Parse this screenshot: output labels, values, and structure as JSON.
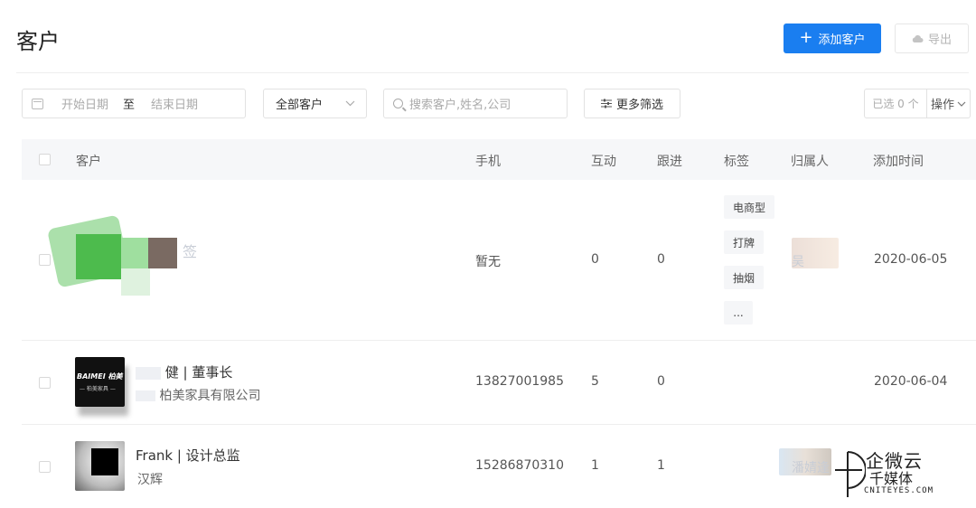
{
  "header": {
    "title": "客户",
    "add_button": "添加客户",
    "add_icon": "+",
    "export_button": "导出"
  },
  "filters": {
    "date_start_placeholder": "开始日期",
    "date_separator": "至",
    "date_end_placeholder": "结束日期",
    "customer_scope": "全部客户",
    "search_placeholder": "搜索客户,姓名,公司",
    "more_filters": "更多筛选",
    "selected_count": "已选 0 个",
    "operation": "操作"
  },
  "table": {
    "columns": [
      "客户",
      "手机",
      "互动",
      "跟进",
      "标签",
      "归属人",
      "添加时间"
    ],
    "rows": [
      {
        "customer_label": "签",
        "phone": "暂无",
        "interactions": "0",
        "followups": "0",
        "tags": [
          "电商型",
          "打牌",
          "抽烟",
          "..."
        ],
        "owner": "吴",
        "added": "2020-06-05"
      },
      {
        "customer_name": "健 | 董事长",
        "company": "柏美家具有限公司",
        "avatar_text": "BAIMEI 柏美",
        "avatar_subtext": "— 柏美家具 —",
        "phone": "13827001985",
        "interactions": "5",
        "followups": "0",
        "added": "2020-06-04"
      },
      {
        "customer_name": "Frank | 设计总监",
        "company": "汉辉",
        "phone": "15286870310",
        "interactions": "1",
        "followups": "1",
        "owner": "潘婧逢"
      }
    ]
  },
  "watermark": {
    "main": "企微云",
    "secondary": "千媒体",
    "site": "CNITEYES.COM"
  },
  "colors": {
    "primary": "#1a7ef0",
    "header_bg": "#f6f7f9",
    "tag_bg": "#f5f6f8"
  }
}
